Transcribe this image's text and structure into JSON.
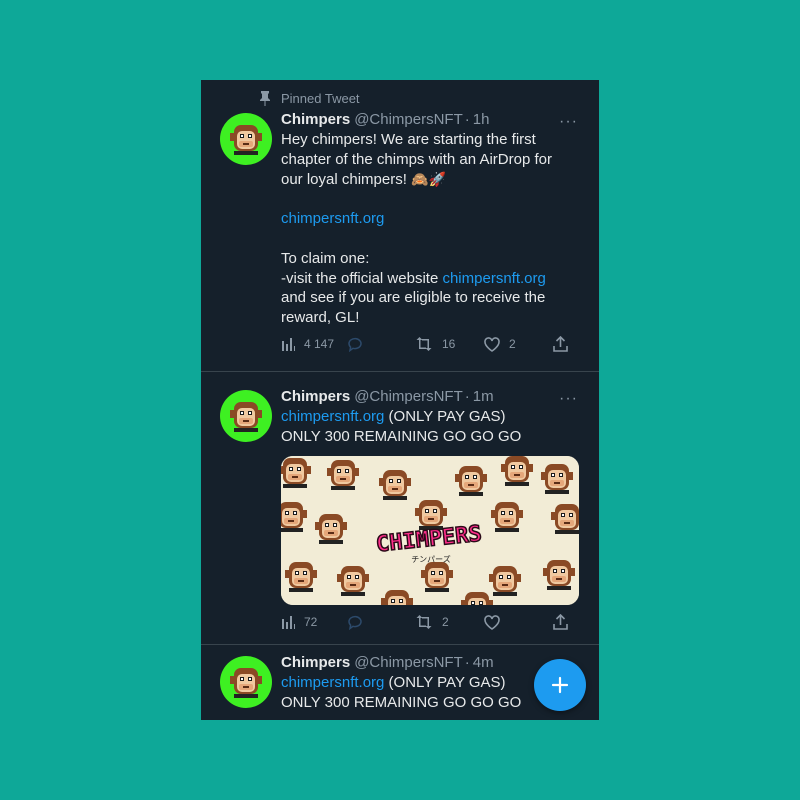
{
  "pinned_label": "Pinned Tweet",
  "colors": {
    "background": "#0ea898",
    "surface": "#15202b",
    "text": "#e7e9ea",
    "muted": "#8b98a5",
    "link": "#1d9bf0",
    "avatar_bg": "#3ef022",
    "fab": "#1d9bf0"
  },
  "tweets": [
    {
      "name": "Chimpers",
      "handle": "@ChimpersNFT",
      "separator": "·",
      "time": "1h",
      "more": "···",
      "lines": {
        "l1": "Hey chimpers! We are starting the first",
        "l2": "chapter of the chimps with an AirDrop for",
        "l3": "our loyal chimpers! ",
        "l3_emoji": "🙈🚀",
        "l4_link": "chimpersnft.org",
        "l5": "To claim one:",
        "l6": "-visit the official website ",
        "l6_link": "chimpersnft.org",
        "l7": "and see if you are eligible to receive the",
        "l8": "reward, GL!"
      },
      "views": "4 147",
      "replies": "",
      "retweets": "16",
      "likes": "2"
    },
    {
      "name": "Chimpers",
      "handle": "@ChimpersNFT",
      "separator": "·",
      "time": "1m",
      "more": "···",
      "link": "chimpersnft.org",
      "line1_rest": " (ONLY PAY GAS)",
      "line2": "ONLY 300 REMAINING GO GO GO",
      "media_title": "CHIMPERS",
      "media_subtitle": "チンパーズ",
      "views": "72",
      "replies": "",
      "retweets": "2",
      "likes": ""
    },
    {
      "name": "Chimpers",
      "handle": "@ChimpersNFT",
      "separator": "·",
      "time": "4m",
      "link": "chimpersnft.org",
      "line1_rest": " (ONLY PAY GAS)",
      "line2": "ONLY 300 REMAINING GO GO GO"
    }
  ],
  "icons": {
    "pin": "pin-icon",
    "views": "bar-chart-icon",
    "reply": "reply-bubble-icon",
    "retweet": "retweet-icon",
    "like": "heart-icon",
    "share": "share-icon",
    "compose": "plus-icon"
  }
}
